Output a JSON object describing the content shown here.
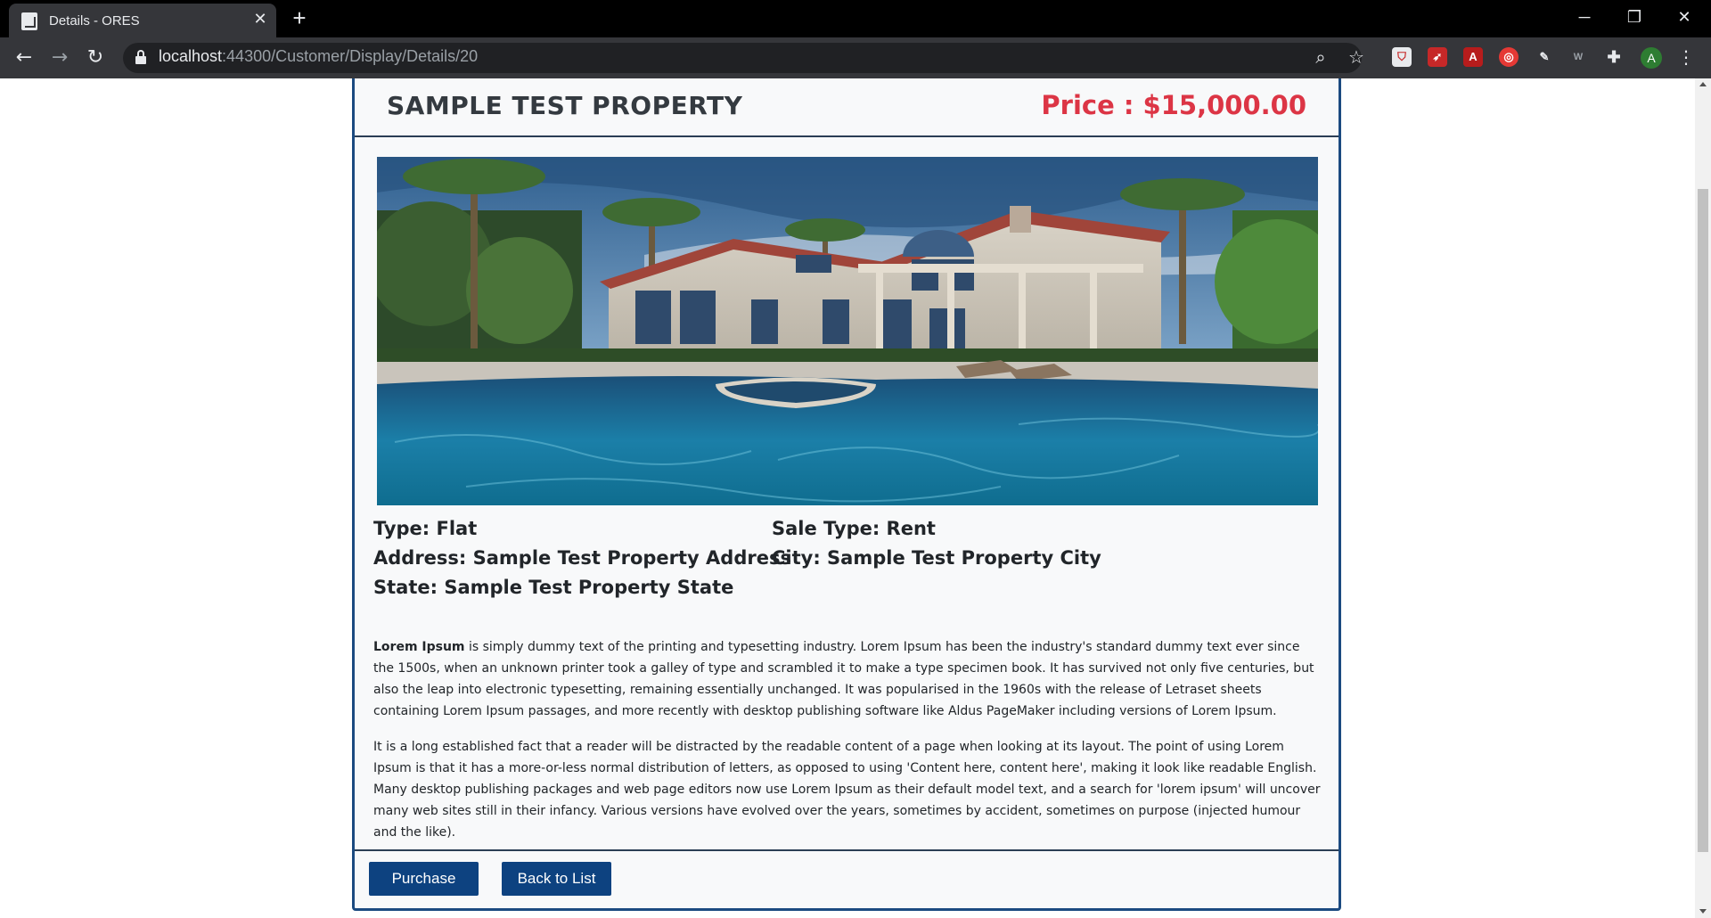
{
  "browser": {
    "tab_title": "Details - ORES",
    "url_host": "localhost",
    "url_path": ":44300/Customer/Display/Details/20",
    "avatar_letter": "A"
  },
  "property": {
    "title": "SAMPLE TEST PROPERTY",
    "price": "Price : $15,000.00",
    "type": "Type: Flat",
    "sale_type": "Sale Type: Rent",
    "address": "Address: Sample Test Property Address",
    "city": "City: Sample Test Property City",
    "state": "State: Sample Test Property State",
    "image_alt": "Property photo: house with swimming pool and palm trees"
  },
  "description": {
    "p1_bold": "Lorem Ipsum",
    "p1_rest": " is simply dummy text of the printing and typesetting industry. Lorem Ipsum has been the industry's standard dummy text ever since the 1500s, when an unknown printer took a galley of type and scrambled it to make a type specimen book. It has survived not only five centuries, but also the leap into electronic typesetting, remaining essentially unchanged. It was popularised in the 1960s with the release of Letraset sheets containing Lorem Ipsum passages, and more recently with desktop publishing software like Aldus PageMaker including versions of Lorem Ipsum.",
    "p2": "It is a long established fact that a reader will be distracted by the readable content of a page when looking at its layout. The point of using Lorem Ipsum is that it has a more-or-less normal distribution of letters, as opposed to using 'Content here, content here', making it look like readable English. Many desktop publishing packages and web page editors now use Lorem Ipsum as their default model text, and a search for 'lorem ipsum' will uncover many web sites still in their infancy. Various versions have evolved over the years, sometimes by accident, sometimes on purpose (injected humour and the like)."
  },
  "actions": {
    "purchase_label": "Purchase",
    "back_label": "Back to List"
  },
  "colors": {
    "brand_blue": "#0d4280",
    "price_red": "#dc3545"
  }
}
